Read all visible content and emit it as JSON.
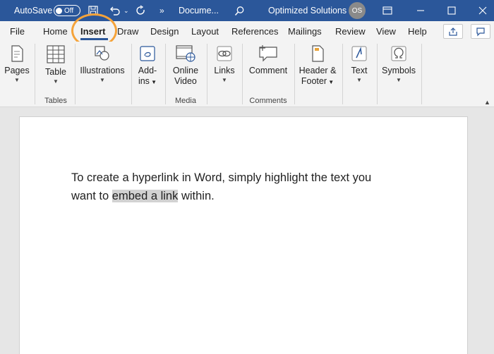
{
  "titlebar": {
    "autosave_label": "AutoSave",
    "autosave_state": "Off",
    "document_name": "Docume...",
    "account_name": "Optimized Solutions",
    "avatar_initials": "OS"
  },
  "menu": {
    "tabs": [
      "File",
      "Home",
      "Insert",
      "Draw",
      "Design",
      "Layout",
      "References",
      "Mailings",
      "Review",
      "View",
      "Help"
    ],
    "active_tab": "Insert"
  },
  "ribbon": {
    "pages": "Pages",
    "table": "Table",
    "illustrations": "Illustrations",
    "addins_1": "Add-",
    "addins_2": "ins",
    "online_video_1": "Online",
    "online_video_2": "Video",
    "links": "Links",
    "comment": "Comment",
    "header_footer_1": "Header &",
    "header_footer_2": "Footer",
    "text": "Text",
    "symbols": "Symbols",
    "groups": {
      "tables": "Tables",
      "media": "Media",
      "comments": "Comments"
    }
  },
  "document": {
    "line1": "To create a hyperlink in Word, simply highlight the text you",
    "line2_before": "want to ",
    "line2_selected": "embed a link",
    "line2_after": " within."
  },
  "colors": {
    "accent": "#2b579a",
    "highlight_ring": "#f5a33a",
    "selection": "#d2d2d2"
  }
}
